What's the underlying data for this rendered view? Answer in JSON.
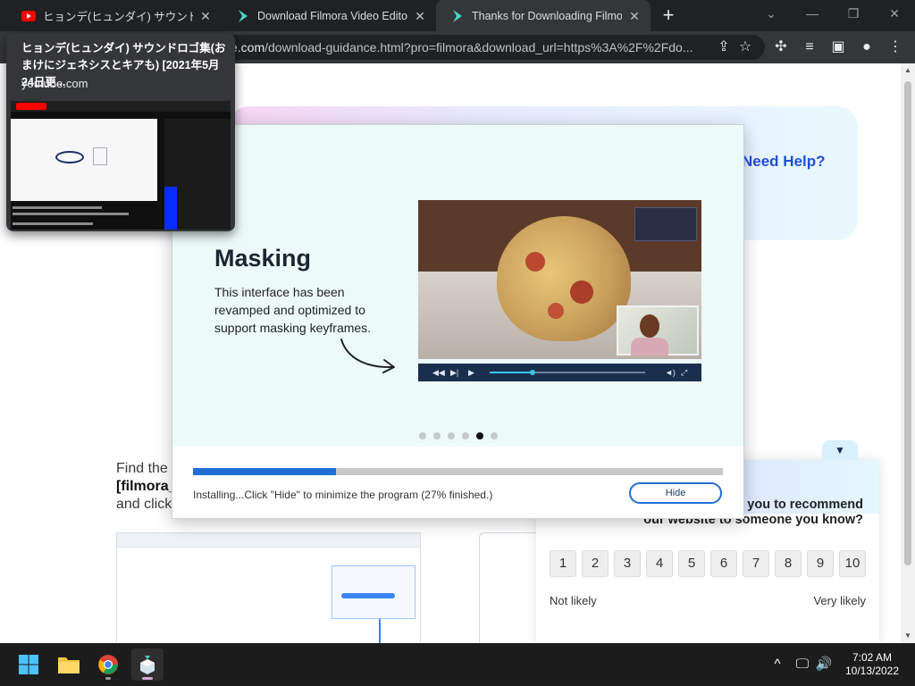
{
  "tabs": [
    {
      "title": "ヒョンデ(ヒュンダイ) サウンドロゴ集(おま",
      "favicon": "youtube-icon",
      "active": false
    },
    {
      "title": "Download Filmora Video Editor",
      "favicon": "filmora-icon",
      "active": false
    },
    {
      "title": "Thanks for Downloading Filmora",
      "favicon": "filmora-icon",
      "active": true
    }
  ],
  "hover_card": {
    "title": "ヒョンデ(ヒュンダイ) サウンドロゴ集(おまけにジェネシスとキアも) [2021年5月24日更...",
    "domain": "youtube.com"
  },
  "address_bar": {
    "host": "e.com",
    "path": "/download-guidance.html?pro=filmora&download_url=https%3A%2F%2Fdo..."
  },
  "page": {
    "need_help": "Need Help?",
    "find_line1": "Find the",
    "find_line2": "[filmora_",
    "find_line3": "and click"
  },
  "installer": {
    "feature_title": "Masking",
    "feature_description": "This interface has been revamped and optimized to support masking keyframes.",
    "slides_total": 6,
    "active_slide": 5,
    "progress": 0.27,
    "status_text": "Installing...Click \"Hide\" to minimize the program (27% finished.)",
    "hide_label": "Hide"
  },
  "survey": {
    "question_line1": "e you to recommend",
    "question_line2": "our website to someone you know?",
    "options": [
      "1",
      "2",
      "3",
      "4",
      "5",
      "6",
      "7",
      "8",
      "9",
      "10"
    ],
    "low_label": "Not likely",
    "high_label": "Very likely"
  },
  "taskbar": {
    "time": "7:02 AM",
    "date": "10/13/2022",
    "apps": [
      "start-icon",
      "file-explorer-icon",
      "chrome-icon",
      "filmora-installer-icon"
    ]
  },
  "colors": {
    "accent_blue": "#1f6fd6",
    "help_blue": "#1e4fd8",
    "dialog_bg": "#ecfbf9",
    "chrome_dark": "#202124"
  }
}
